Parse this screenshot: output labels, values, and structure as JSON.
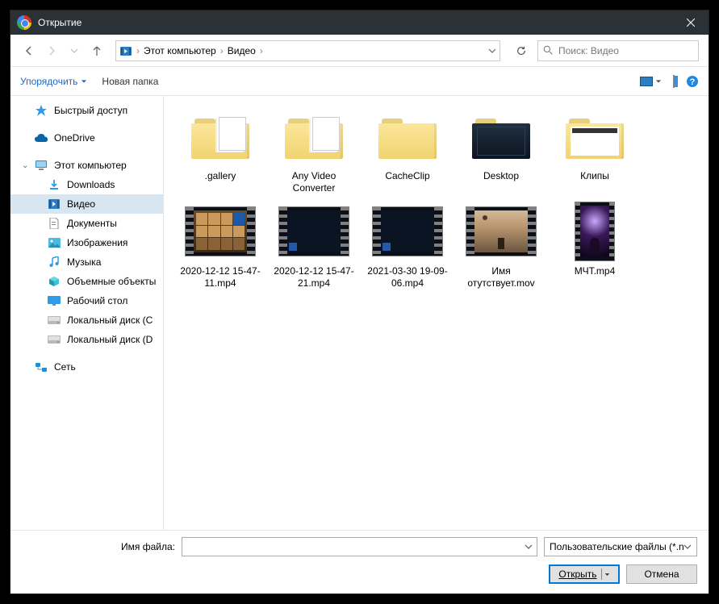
{
  "window": {
    "title": "Открытие"
  },
  "address": {
    "root": "Этот компьютер",
    "segment": "Видео"
  },
  "search": {
    "placeholder": "Поиск: Видео"
  },
  "toolbar": {
    "organize": "Упорядочить",
    "new_folder": "Новая папка"
  },
  "sidebar": {
    "quick": "Быстрый доступ",
    "onedrive": "OneDrive",
    "this_pc": "Этот компьютер",
    "children": {
      "downloads": "Downloads",
      "video": "Видео",
      "documents": "Документы",
      "images": "Изображения",
      "music": "Музыка",
      "objects3d": "Объемные объекты",
      "desktop": "Рабочий стол",
      "disk_c": "Локальный диск (C",
      "disk_d": "Локальный диск (D"
    },
    "network": "Сеть"
  },
  "items": [
    {
      "name": ".gallery",
      "type": "folder-papers"
    },
    {
      "name": "Any Video Converter",
      "type": "folder-papers"
    },
    {
      "name": "CacheClip",
      "type": "folder"
    },
    {
      "name": "Desktop",
      "type": "folder-dark"
    },
    {
      "name": "Клипы",
      "type": "folder-clips"
    },
    {
      "name": "2020-12-12 15-47-11.mp4",
      "type": "video-game"
    },
    {
      "name": "2020-12-12 15-47-21.mp4",
      "type": "video-dark"
    },
    {
      "name": "2021-03-30 19-09-06.mp4",
      "type": "video-dark"
    },
    {
      "name": "Имя отутствует.mov",
      "type": "video-sunset"
    },
    {
      "name": "МЧТ.mp4",
      "type": "video-concert"
    }
  ],
  "bottom": {
    "label": "Имя файла:",
    "filter": "Пользовательские файлы (*.n",
    "open": "Открыть",
    "cancel": "Отмена"
  }
}
